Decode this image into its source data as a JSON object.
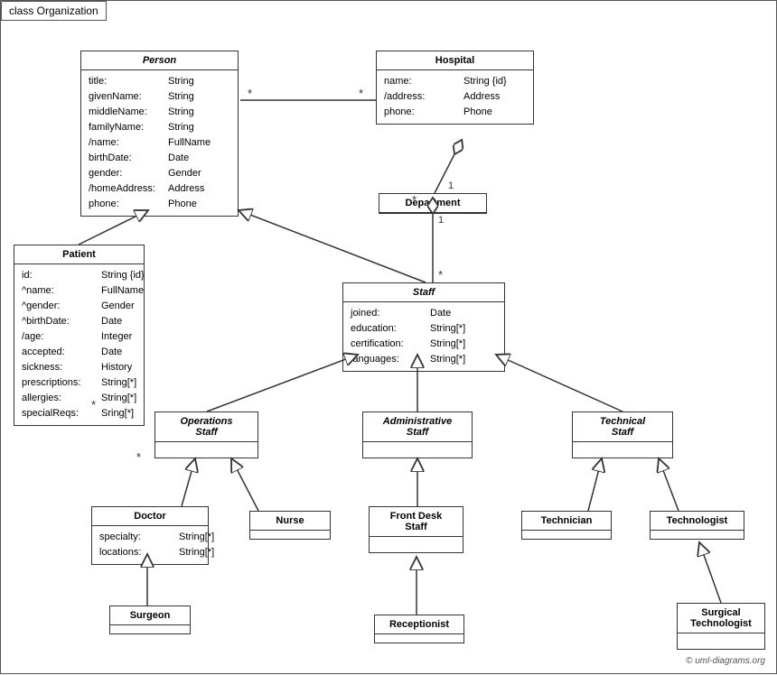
{
  "diagram": {
    "title": "class Organization",
    "classes": {
      "person": {
        "name": "Person",
        "italic": true,
        "attrs": [
          [
            "title:",
            "String"
          ],
          [
            "givenName:",
            "String"
          ],
          [
            "middleName:",
            "String"
          ],
          [
            "familyName:",
            "String"
          ],
          [
            "/name:",
            "FullName"
          ],
          [
            "birthDate:",
            "Date"
          ],
          [
            "gender:",
            "Gender"
          ],
          [
            "/homeAddress:",
            "Address"
          ],
          [
            "phone:",
            "Phone"
          ]
        ]
      },
      "hospital": {
        "name": "Hospital",
        "italic": false,
        "attrs": [
          [
            "name:",
            "String {id}"
          ],
          [
            "/address:",
            "Address"
          ],
          [
            "phone:",
            "Phone"
          ]
        ]
      },
      "department": {
        "name": "Department",
        "italic": false,
        "attrs": []
      },
      "staff": {
        "name": "Staff",
        "italic": true,
        "attrs": [
          [
            "joined:",
            "Date"
          ],
          [
            "education:",
            "String[*]"
          ],
          [
            "certification:",
            "String[*]"
          ],
          [
            "languages:",
            "String[*]"
          ]
        ]
      },
      "patient": {
        "name": "Patient",
        "italic": false,
        "attrs": [
          [
            "id:",
            "String {id}"
          ],
          [
            "^name:",
            "FullName"
          ],
          [
            "^gender:",
            "Gender"
          ],
          [
            "^birthDate:",
            "Date"
          ],
          [
            "/age:",
            "Integer"
          ],
          [
            "accepted:",
            "Date"
          ],
          [
            "sickness:",
            "History"
          ],
          [
            "prescriptions:",
            "String[*]"
          ],
          [
            "allergies:",
            "String[*]"
          ],
          [
            "specialReqs:",
            "Sring[*]"
          ]
        ]
      },
      "operations_staff": {
        "name": "Operations\nStaff",
        "italic": true,
        "attrs": []
      },
      "administrative_staff": {
        "name": "Administrative\nStaff",
        "italic": true,
        "attrs": []
      },
      "technical_staff": {
        "name": "Technical\nStaff",
        "italic": true,
        "attrs": []
      },
      "doctor": {
        "name": "Doctor",
        "italic": false,
        "attrs": [
          [
            "specialty:",
            "String[*]"
          ],
          [
            "locations:",
            "String[*]"
          ]
        ]
      },
      "nurse": {
        "name": "Nurse",
        "italic": false,
        "attrs": []
      },
      "front_desk_staff": {
        "name": "Front Desk\nStaff",
        "italic": false,
        "attrs": []
      },
      "technician": {
        "name": "Technician",
        "italic": false,
        "attrs": []
      },
      "technologist": {
        "name": "Technologist",
        "italic": false,
        "attrs": []
      },
      "surgeon": {
        "name": "Surgeon",
        "italic": false,
        "attrs": []
      },
      "receptionist": {
        "name": "Receptionist",
        "italic": false,
        "attrs": []
      },
      "surgical_technologist": {
        "name": "Surgical\nTechnologist",
        "italic": false,
        "attrs": []
      }
    },
    "copyright": "© uml-diagrams.org"
  }
}
